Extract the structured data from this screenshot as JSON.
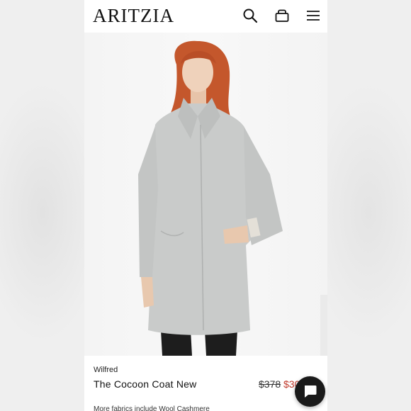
{
  "header": {
    "logo": "ARITZIA",
    "icons": [
      "search-icon",
      "bag-icon",
      "menu-icon"
    ]
  },
  "product": {
    "brand": "Wilfred",
    "name": "The Cocoon Coat New",
    "price_original": "$378",
    "price_sale": "$30",
    "more_fabrics": "More fabrics include Wool Cashmere"
  },
  "colors": {
    "sale": "#c0392b",
    "coat": "#c9cbca",
    "hair": "#c4572c",
    "chat_button": "#1a1a1a"
  },
  "chat": {
    "icon": "chat-bubble-icon"
  }
}
